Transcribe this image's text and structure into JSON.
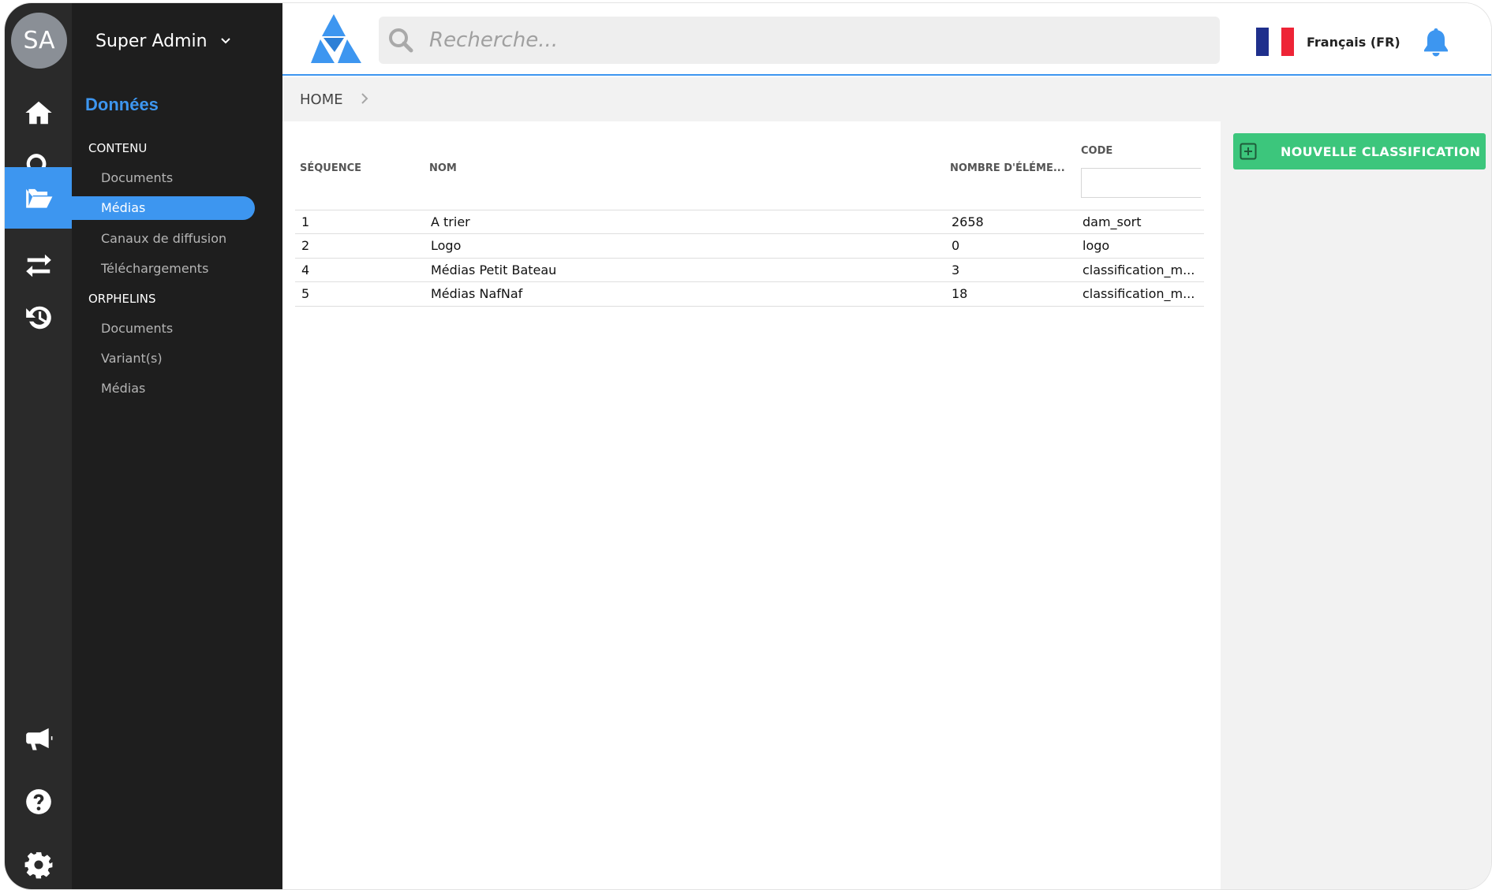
{
  "user": {
    "initials": "SA",
    "name": "Super Admin"
  },
  "rail": {
    "items": [
      {
        "icon": "home-icon"
      },
      {
        "icon": "search-icon"
      },
      {
        "icon": "folder-open-icon",
        "active": true
      },
      {
        "icon": "exchange-icon"
      },
      {
        "icon": "history-icon"
      }
    ],
    "bottom": [
      {
        "icon": "megaphone-icon"
      },
      {
        "icon": "help-icon"
      },
      {
        "icon": "gear-icon"
      }
    ]
  },
  "panel": {
    "title": "Données",
    "sections": [
      {
        "label": "CONTENU",
        "items": [
          "Documents",
          "Médias",
          "Canaux de diffusion",
          "Téléchargements"
        ]
      },
      {
        "label": "ORPHELINS",
        "items": [
          "Documents",
          "Variant(s)",
          "Médias"
        ]
      }
    ],
    "active_item": "Médias"
  },
  "search": {
    "placeholder": "Recherche..."
  },
  "language": {
    "label": "Français (FR)",
    "flag_colors": [
      "#1f2f8c",
      "#ffffff",
      "#ee2436"
    ]
  },
  "breadcrumb": {
    "home": "HOME"
  },
  "actions": {
    "new_classification": "NOUVELLE CLASSIFICATION"
  },
  "table": {
    "columns": {
      "sequence": "SÉQUENCE",
      "name": "NOM",
      "count": "NOMBRE D'ÉLÉME...",
      "code": "CODE"
    },
    "rows": [
      {
        "sequence": "1",
        "name": "A trier",
        "count": "2658",
        "code": "dam_sort"
      },
      {
        "sequence": "2",
        "name": "Logo",
        "count": "0",
        "code": "logo"
      },
      {
        "sequence": "4",
        "name": "Médias Petit Bateau",
        "count": "3",
        "code": "classification_m..."
      },
      {
        "sequence": "5",
        "name": "Médias NafNaf",
        "count": "18",
        "code": "classification_m..."
      }
    ]
  },
  "colors": {
    "accent": "#3d96f0",
    "success": "#3cc67c",
    "rail": "#2a2a2a",
    "panel": "#1e1e1e"
  }
}
